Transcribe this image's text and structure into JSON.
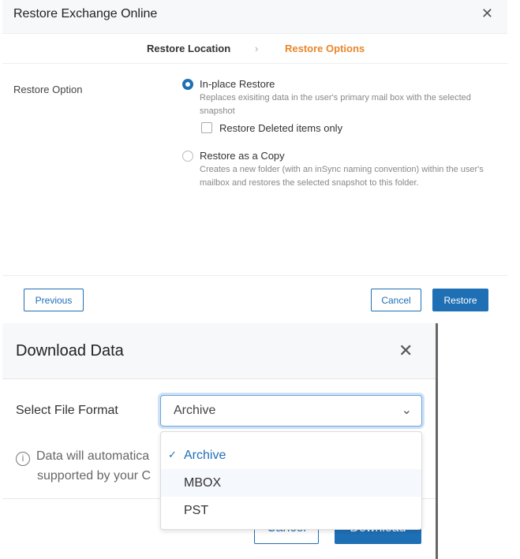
{
  "restore_dialog": {
    "title": "Restore Exchange Online",
    "close_icon": "close-icon",
    "steps": [
      "Restore Location",
      "Restore Options"
    ],
    "active_step": "Restore Options",
    "field_label": "Restore Option",
    "options": [
      {
        "title": "In-place Restore",
        "desc": "Replaces exisiting data in the user's primary mail box with the selected snapshot",
        "selected": true
      },
      {
        "title": "Restore as a Copy",
        "desc": "Creates a new folder (with an inSync naming convention) within the user's mailbox and restores the selected snapshot to this folder.",
        "selected": false
      }
    ],
    "checkbox_label": "Restore Deleted items only",
    "buttons": {
      "previous": "Previous",
      "cancel": "Cancel",
      "restore": "Restore"
    },
    "accent": "#1f6fb5",
    "step_active_color": "#e8862b"
  },
  "download_dialog": {
    "title": "Download Data",
    "field_label": "Select File Format",
    "selected_value": "Archive",
    "info_line1": "Data will automatica",
    "info_line2": "supported by your C",
    "dropdown_options": [
      "Archive",
      "MBOX",
      "PST"
    ],
    "buttons": {
      "cancel": "Cancel",
      "download": "Download"
    }
  }
}
